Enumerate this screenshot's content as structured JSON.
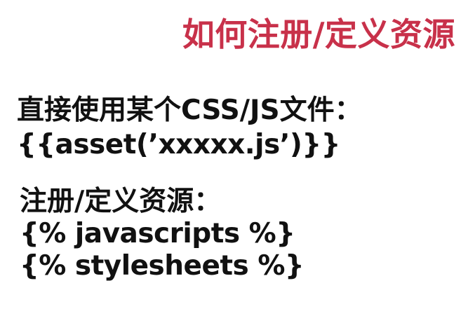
{
  "slide": {
    "title": "如何注册/定义资源",
    "section_direct": {
      "heading": "直接使用某个CSS/JS文件：",
      "code": "{{asset(’xxxxx.js’)}}"
    },
    "section_register": {
      "heading": "注册/定义资源：",
      "code_lines": [
        "{% javascripts %}",
        "{% stylesheets %}"
      ]
    },
    "colors": {
      "title": "#c8314a",
      "text": "#111111",
      "background": "#ffffff"
    }
  }
}
